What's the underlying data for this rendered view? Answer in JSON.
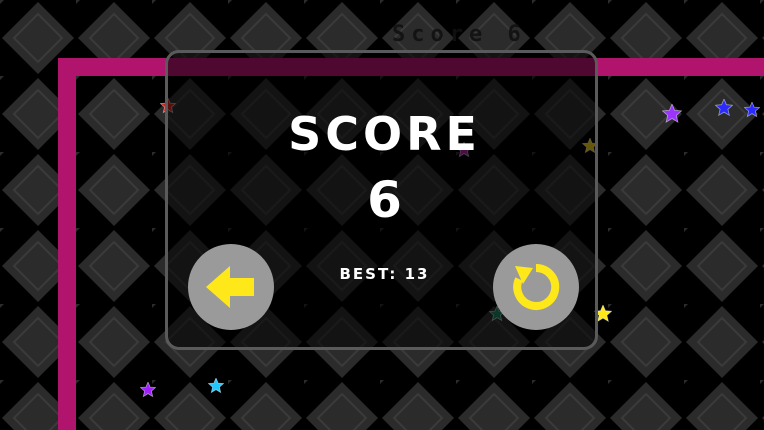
{
  "hud": {
    "score_text": "Score 6"
  },
  "dialog": {
    "title": "SCORE",
    "score": "6",
    "best_text": "BEST: 13"
  },
  "buttons": {
    "back_icon": "arrow-left-icon",
    "restart_icon": "restart-icon"
  },
  "colors": {
    "background": "#000000",
    "tile_fill": "#2b2b2b",
    "wall": "#b0146d",
    "button_bg": "#9a9a9a",
    "button_icon": "#ffe81a"
  },
  "stars": [
    {
      "color": "#c8231c"
    },
    {
      "color": "#a020a0"
    },
    {
      "color": "#9b34ff"
    },
    {
      "color": "#2a2aff"
    },
    {
      "color": "#2a2aff"
    },
    {
      "color": "#e0c21a"
    },
    {
      "color": "#ffe81a"
    },
    {
      "color": "#1a7a5a"
    },
    {
      "color": "#30c8a8"
    },
    {
      "color": "#a020ff"
    },
    {
      "color": "#20c8ff"
    }
  ]
}
